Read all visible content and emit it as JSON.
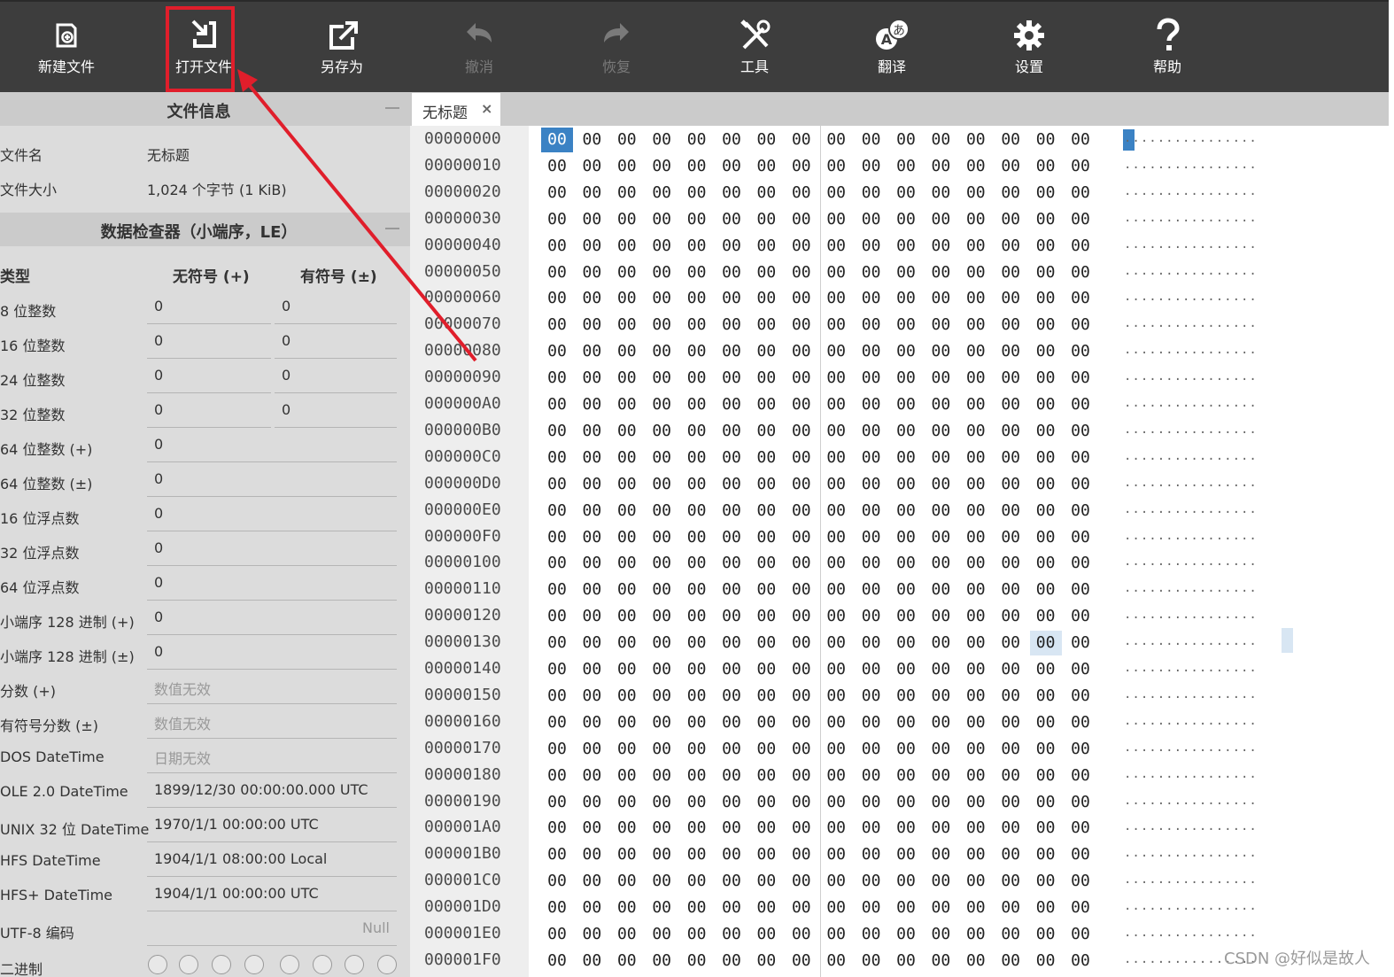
{
  "toolbar": {
    "items": [
      {
        "label": "新建文件",
        "icon": "new-file-icon",
        "enabled": true
      },
      {
        "label": "打开文件",
        "icon": "open-file-icon",
        "enabled": true
      },
      {
        "label": "另存为",
        "icon": "save-as-icon",
        "enabled": true
      },
      {
        "label": "撤消",
        "icon": "undo-icon",
        "enabled": false
      },
      {
        "label": "恢复",
        "icon": "redo-icon",
        "enabled": false
      },
      {
        "label": "工具",
        "icon": "tools-icon",
        "enabled": true
      },
      {
        "label": "翻译",
        "icon": "translate-icon",
        "enabled": true
      },
      {
        "label": "设置",
        "icon": "settings-icon",
        "enabled": true
      },
      {
        "label": "帮助",
        "icon": "help-icon",
        "enabled": true
      }
    ]
  },
  "sidebar": {
    "file_info": {
      "title": "文件信息",
      "rows": [
        {
          "label": "文件名",
          "value": "无标题"
        },
        {
          "label": "文件大小",
          "value": "1,024 个字节 (1 KiB)"
        }
      ]
    },
    "inspector": {
      "title": "数据检查器（小端序，LE）",
      "col_type": "类型",
      "col_unsigned": "无符号 (+)",
      "col_signed": "有符号 (±)",
      "rows": [
        {
          "label": "8 位整数",
          "unsigned": "0",
          "signed": "0"
        },
        {
          "label": "16 位整数",
          "unsigned": "0",
          "signed": "0"
        },
        {
          "label": "24 位整数",
          "unsigned": "0",
          "signed": "0"
        },
        {
          "label": "32 位整数",
          "unsigned": "0",
          "signed": "0"
        },
        {
          "label": "64 位整数 (+)",
          "value": "0"
        },
        {
          "label": "64 位整数 (±)",
          "value": "0"
        },
        {
          "label": "16 位浮点数",
          "value": "0"
        },
        {
          "label": "32 位浮点数",
          "value": "0"
        },
        {
          "label": "64 位浮点数",
          "value": "0"
        },
        {
          "label": "小端序 128 进制 (+)",
          "value": "0"
        },
        {
          "label": "小端序 128 进制 (±)",
          "value": "0"
        },
        {
          "label": "分数 (+)",
          "value": "数值无效"
        },
        {
          "label": "有符号分数 (±)",
          "value": "数值无效"
        },
        {
          "label": "DOS DateTime",
          "value": "日期无效"
        },
        {
          "label": "OLE 2.0 DateTime",
          "value": "1899/12/30 00:00:00.000 UTC"
        },
        {
          "label": "UNIX 32 位 DateTime",
          "value": "1970/1/1 00:00:00 UTC"
        },
        {
          "label": "HFS DateTime",
          "value": "1904/1/1 08:00:00 Local"
        },
        {
          "label": "HFS+ DateTime",
          "value": "1904/1/1 00:00:00 UTC"
        },
        {
          "label": "UTF-8 编码",
          "value": "Null"
        },
        {
          "label": "二进制",
          "value": ""
        }
      ]
    }
  },
  "tab": {
    "label": "无标题",
    "close": "×"
  },
  "hex": {
    "offsets": [
      "00000000",
      "00000010",
      "00000020",
      "00000030",
      "00000040",
      "00000050",
      "00000060",
      "00000070",
      "00000080",
      "00000090",
      "000000A0",
      "000000B0",
      "000000C0",
      "000000D0",
      "000000E0",
      "000000F0",
      "00000100",
      "00000110",
      "00000120",
      "00000130",
      "00000140",
      "00000150",
      "00000160",
      "00000170",
      "00000180",
      "00000190",
      "000001A0",
      "000001B0",
      "000001C0",
      "000001D0",
      "000001E0",
      "000001F0"
    ],
    "byte": "00",
    "ascii": "................"
  },
  "watermark": "CSDN @好似是故人",
  "colors": {
    "annotation": "#e01e2b",
    "selection": "#3b82c4",
    "toolbar_bg": "#3d3d3d"
  }
}
